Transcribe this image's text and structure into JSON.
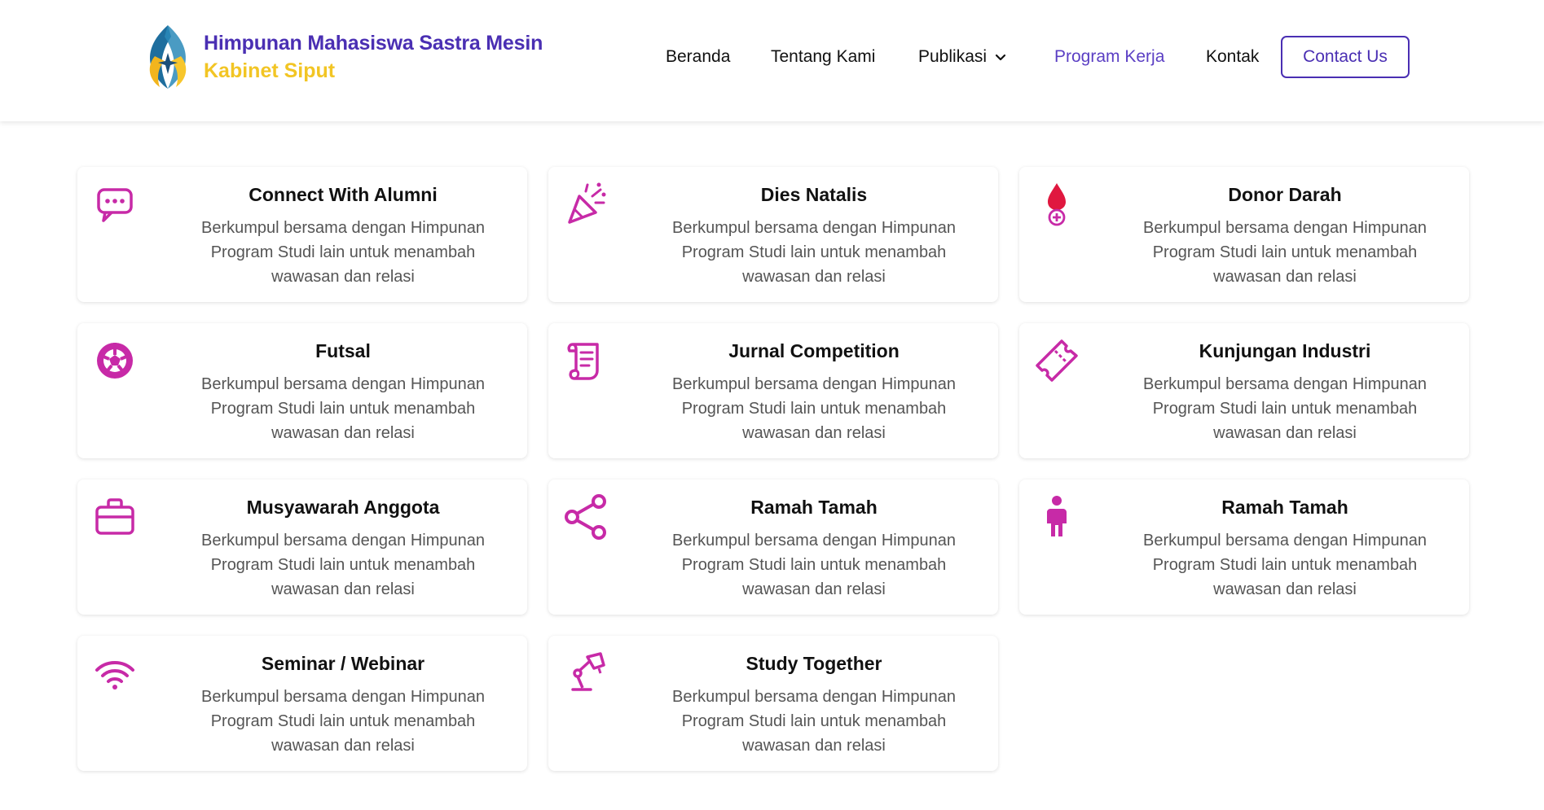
{
  "brand": {
    "title": "Himpunan Mahasiswa Sastra Mesin",
    "subtitle": "Kabinet Siput"
  },
  "nav": {
    "items": [
      {
        "label": "Beranda"
      },
      {
        "label": "Tentang Kami"
      },
      {
        "label": "Publikasi"
      },
      {
        "label": "Program Kerja"
      },
      {
        "label": "Kontak"
      }
    ],
    "active": "Program Kerja",
    "contact_button": "Contact Us"
  },
  "colors": {
    "accent": "#4a2fb3",
    "brand_yellow": "#f2c524",
    "icon": "#c72aa7"
  },
  "programs": [
    {
      "title": "Connect With Alumni",
      "icon": "chat-bubble-icon",
      "desc": "Berkumpul bersama dengan Himpunan Program Studi lain untuk menambah wawasan dan relasi"
    },
    {
      "title": "Dies Natalis",
      "icon": "party-popper-icon",
      "desc": "Berkumpul bersama dengan Himpunan Program Studi lain untuk menambah wawasan dan relasi"
    },
    {
      "title": "Donor Darah",
      "icon": "blood-drop-icon",
      "desc": "Berkumpul bersama dengan Himpunan Program Studi lain untuk menambah wawasan dan relasi"
    },
    {
      "title": "Futsal",
      "icon": "soccer-ball-icon",
      "desc": "Berkumpul bersama dengan Himpunan Program Studi lain untuk menambah wawasan dan relasi"
    },
    {
      "title": "Jurnal Competition",
      "icon": "scroll-icon",
      "desc": "Berkumpul bersama dengan Himpunan Program Studi lain untuk menambah wawasan dan relasi"
    },
    {
      "title": "Kunjungan Industri",
      "icon": "ticket-icon",
      "desc": "Berkumpul bersama dengan Himpunan Program Studi lain untuk menambah wawasan dan relasi"
    },
    {
      "title": "Musyawarah Anggota",
      "icon": "briefcase-icon",
      "desc": "Berkumpul bersama dengan Himpunan Program Studi lain untuk menambah wawasan dan relasi"
    },
    {
      "title": "Ramah Tamah",
      "icon": "share-icon",
      "desc": "Berkumpul bersama dengan Himpunan Program Studi lain untuk menambah wawasan dan relasi"
    },
    {
      "title": "Ramah Tamah",
      "icon": "person-icon",
      "desc": "Berkumpul bersama dengan Himpunan Program Studi lain untuk menambah wawasan dan relasi"
    },
    {
      "title": "Seminar / Webinar",
      "icon": "wifi-icon",
      "desc": "Berkumpul bersama dengan Himpunan Program Studi lain untuk menambah wawasan dan relasi"
    },
    {
      "title": "Study Together",
      "icon": "desk-lamp-icon",
      "desc": "Berkumpul bersama dengan Himpunan Program Studi lain untuk menambah wawasan dan relasi"
    }
  ]
}
